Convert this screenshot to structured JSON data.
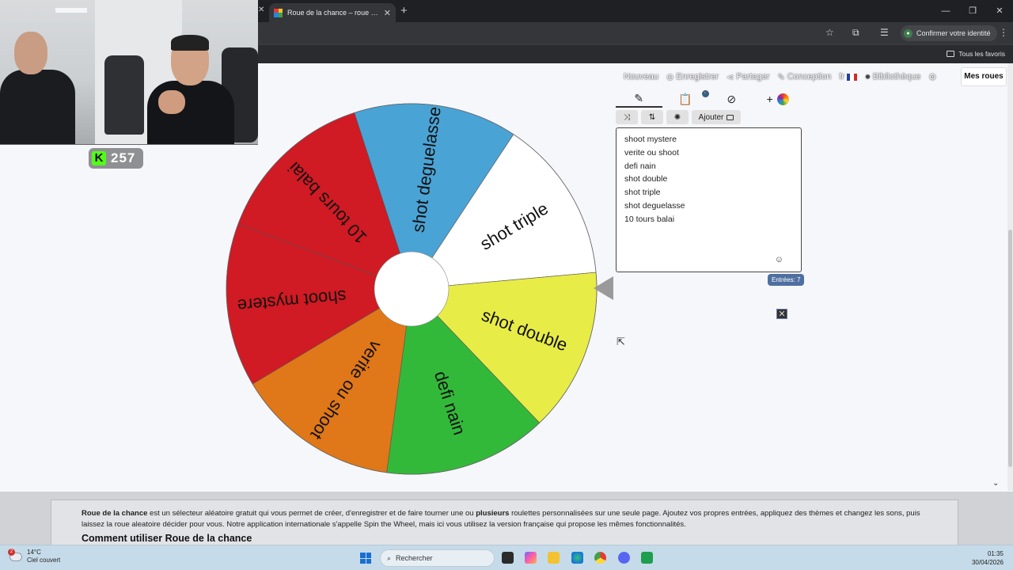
{
  "browser": {
    "tab_title": "Roue de la chance – roue aléatoire",
    "tab_close": "✕",
    "new_tab": "+",
    "left_close": "✕",
    "window_controls": [
      "—",
      "❐",
      "✕"
    ],
    "identity_button": "Confirmer votre identité",
    "bookmarks_all": "Tous les favoris"
  },
  "stream": {
    "follower_count": "257",
    "kick_logo": "K"
  },
  "site_nav": {
    "new": "Nouveau",
    "save": "Enregistrer",
    "share": "Partager",
    "design": "Conception",
    "lang": "fr",
    "gallery": "Bibliothèque",
    "my_wheels": "Mes roues"
  },
  "wheel": {
    "segments": [
      {
        "label": "shot deguelasse",
        "color": "#4aa3d5"
      },
      {
        "label": "shot triple",
        "color": "#ffffff"
      },
      {
        "label": "shot double",
        "color": "#e8ec46"
      },
      {
        "label": "defi nain",
        "color": "#33b93a"
      },
      {
        "label": "verite ou shoot",
        "color": "#e07718"
      },
      {
        "label": "shoot mystere",
        "color": "#d01a24"
      },
      {
        "label": "10 tours balai",
        "color": "#d01a24"
      }
    ]
  },
  "panel": {
    "add_button": "Ajouter",
    "entries": [
      "shoot mystere",
      "verite ou shoot",
      "defi nain",
      "shot double",
      "shot triple",
      "shot deguelasse",
      "10 tours balai"
    ],
    "entry_count": "Entrées: 7",
    "close_symbol": "✕"
  },
  "info": {
    "brand": "Roue de la chance",
    "text_1": " est un sélecteur aléatoire gratuit qui vous permet de créer, d'enregistrer et de faire tourner une ou ",
    "bold_word": "plusieurs",
    "text_2": " roulettes personnalisées sur une seule page. Ajoutez vos propres entrées, appliquez des thèmes et changez les sons, puis laissez la roue aleatoire décider pour vous. Notre application internationale s'appelle Spin the Wheel, mais ici vous utilisez la version française qui propose les mêmes fonctionnalités.",
    "heading": "Comment utiliser Roue de la chance"
  },
  "taskbar": {
    "temperature": "14°C",
    "weather": "Ciel couvert",
    "weather_badge": "2",
    "search_placeholder": "Rechercher",
    "time": "01:35",
    "date": "30/04/2026"
  }
}
